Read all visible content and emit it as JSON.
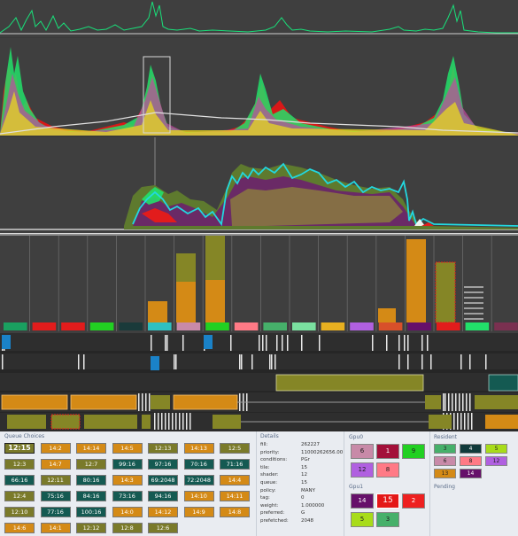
{
  "queue_choices": {
    "title": "Queue Choices",
    "buttons": [
      {
        "label": "12:15",
        "color": "#7a7a2a",
        "selected": true
      },
      {
        "label": "14:2",
        "color": "#d48a16"
      },
      {
        "label": "14:14",
        "color": "#d48a16"
      },
      {
        "label": "14:5",
        "color": "#d48a16"
      },
      {
        "label": "12:13",
        "color": "#7a7a2a"
      },
      {
        "label": "14:13",
        "color": "#d48a16"
      },
      {
        "label": "12:5",
        "color": "#7a7a2a"
      },
      {
        "label": "12:3",
        "color": "#7a7a2a"
      },
      {
        "label": "14:7",
        "color": "#d48a16"
      },
      {
        "label": "12:7",
        "color": "#7a7a2a"
      },
      {
        "label": "99:16",
        "color": "#145a52"
      },
      {
        "label": "97:16",
        "color": "#145a52"
      },
      {
        "label": "70:16",
        "color": "#145a52"
      },
      {
        "label": "71:16",
        "color": "#145a52"
      },
      {
        "label": "66:16",
        "color": "#145a52"
      },
      {
        "label": "12:11",
        "color": "#7a7a2a"
      },
      {
        "label": "80:16",
        "color": "#145a52"
      },
      {
        "label": "14:3",
        "color": "#d48a16"
      },
      {
        "label": "69:2048",
        "color": "#145a52"
      },
      {
        "label": "72:2048",
        "color": "#145a52"
      },
      {
        "label": "14:4",
        "color": "#d48a16"
      },
      {
        "label": "12:4",
        "color": "#7a7a2a"
      },
      {
        "label": "75:16",
        "color": "#145a52"
      },
      {
        "label": "84:16",
        "color": "#145a52"
      },
      {
        "label": "73:16",
        "color": "#145a52"
      },
      {
        "label": "94:16",
        "color": "#145a52"
      },
      {
        "label": "14:10",
        "color": "#d48a16"
      },
      {
        "label": "14:11",
        "color": "#d48a16"
      },
      {
        "label": "12:10",
        "color": "#7a7a2a"
      },
      {
        "label": "77:16",
        "color": "#145a52"
      },
      {
        "label": "100:16",
        "color": "#145a52"
      },
      {
        "label": "14:0",
        "color": "#d48a16"
      },
      {
        "label": "14:12",
        "color": "#d48a16"
      },
      {
        "label": "14:9",
        "color": "#d48a16"
      },
      {
        "label": "14:8",
        "color": "#d48a16"
      },
      {
        "label": "14:6",
        "color": "#d48a16"
      },
      {
        "label": "14:1",
        "color": "#d48a16"
      },
      {
        "label": "12:12",
        "color": "#7a7a2a"
      },
      {
        "label": "12:8",
        "color": "#7a7a2a"
      },
      {
        "label": "12:6",
        "color": "#7a7a2a"
      }
    ]
  },
  "details": {
    "title": "Details",
    "rows": [
      {
        "key": "fill:",
        "value": "262227"
      },
      {
        "key": "priority:",
        "value": "11000262656.00"
      },
      {
        "key": "conditions:",
        "value": "PGr"
      },
      {
        "key": "tile:",
        "value": "15"
      },
      {
        "key": "shader:",
        "value": "12"
      },
      {
        "key": "queue:",
        "value": "15"
      },
      {
        "key": "policy:",
        "value": "MANY"
      },
      {
        "key": "tag:",
        "value": "0"
      },
      {
        "key": "weight:",
        "value": "1.000000"
      },
      {
        "key": "preferred:",
        "value": "G"
      },
      {
        "key": "prefetched:",
        "value": "2048"
      }
    ]
  },
  "gpu0": {
    "title": "Gpu0",
    "tiles": [
      {
        "label": "6",
        "color": "#c88aa8"
      },
      {
        "label": "1",
        "color": "#a3103a",
        "text": "#ffffff"
      },
      {
        "label": "9",
        "color": "#22d022"
      },
      {
        "label": "12",
        "color": "#b060e0"
      },
      {
        "label": "8",
        "color": "#ff7a86"
      }
    ]
  },
  "gpu1": {
    "title": "Gpu1",
    "tiles": [
      {
        "label": "14",
        "color": "#66106a",
        "text": "#ffffff"
      },
      {
        "label": "15",
        "color": "#e41818",
        "text": "#ffffff"
      },
      {
        "label": "2",
        "color": "#ee2020",
        "text": "#ffffff"
      },
      {
        "label": "5",
        "color": "#a8dc1a"
      },
      {
        "label": "3",
        "color": "#46b06a"
      }
    ]
  },
  "resident": {
    "title": "Resident",
    "tiles": [
      {
        "label": "3",
        "color": "#46b06a"
      },
      {
        "label": "4",
        "color": "#103a3a",
        "text": "#ffffff"
      },
      {
        "label": "5",
        "color": "#a8dc1a"
      },
      {
        "label": "6",
        "color": "#c88aa8"
      },
      {
        "label": "8",
        "color": "#ff7a86"
      },
      {
        "label": "12",
        "color": "#b060e0"
      },
      {
        "label": "13",
        "color": "#d48a16"
      },
      {
        "label": "14",
        "color": "#66106a",
        "text": "#ffffff"
      }
    ]
  },
  "pending": {
    "title": "Pending"
  },
  "colors": {
    "panel_bg": "#3f3f3f",
    "green": "#22e06a",
    "orange": "#d48a16",
    "olive": "#7a7a2a",
    "teal": "#145a52"
  }
}
